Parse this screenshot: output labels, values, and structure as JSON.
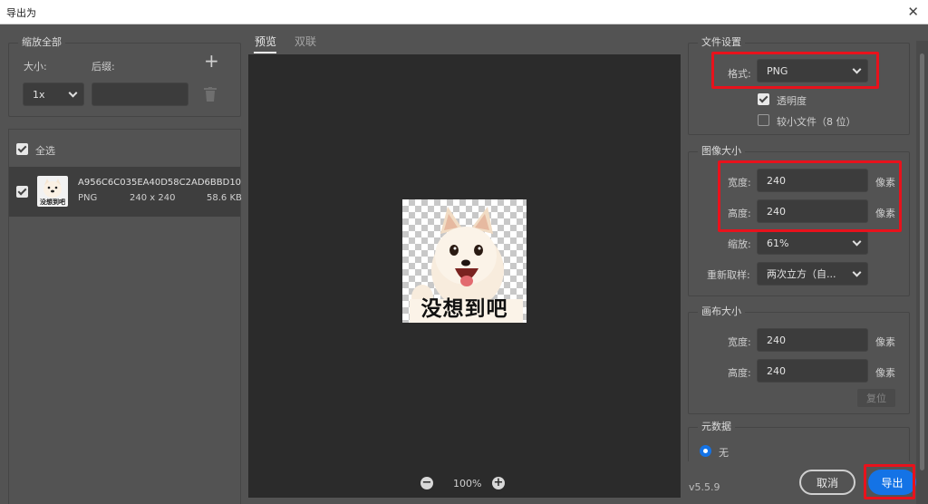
{
  "window": {
    "title": "导出为",
    "close_glyph": "✕"
  },
  "left": {
    "scale_all": {
      "legend": "缩放全部",
      "size_label": "大小:",
      "suffix_label": "后缀:",
      "size_value": "1x",
      "suffix_value": "",
      "add_glyph": "+"
    },
    "select_all_label": "全选",
    "file": {
      "name": "A956C6C035EA40D58C2AD6BBD10",
      "format": "PNG",
      "dimensions": "240 x 240",
      "filesize": "58.6 KB",
      "thumb_caption": "没想到吧"
    }
  },
  "preview": {
    "tabs": [
      "预览",
      "双联"
    ],
    "active_tab": 0,
    "image_caption": "没想到吧",
    "zoom": "100%",
    "zoom_out_glyph": "−",
    "zoom_in_glyph": "+"
  },
  "file_settings": {
    "legend": "文件设置",
    "format_label": "格式:",
    "format_value": "PNG",
    "transparency_label": "透明度",
    "transparency_checked": true,
    "smaller_file_label": "较小文件（8 位）",
    "smaller_file_checked": false
  },
  "image_size": {
    "legend": "图像大小",
    "width_label": "宽度:",
    "width_value": "240",
    "height_label": "高度:",
    "height_value": "240",
    "unit": "像素",
    "scale_label": "缩放:",
    "scale_value": "61%",
    "resample_label": "重新取样:",
    "resample_value": "两次立方（自..."
  },
  "canvas_size": {
    "legend": "画布大小",
    "width_label": "宽度:",
    "width_value": "240",
    "height_label": "高度:",
    "height_value": "240",
    "unit": "像素",
    "reset_label": "复位"
  },
  "metadata": {
    "legend": "元数据",
    "option_none": "无"
  },
  "footer": {
    "version": "v5.5.9",
    "cancel_label": "取消",
    "export_label": "导出"
  },
  "colors": {
    "accent_blue": "#1473e6",
    "highlight_red": "#e8121c",
    "panel_bg": "#535353",
    "preview_bg": "#2b2b2b"
  }
}
